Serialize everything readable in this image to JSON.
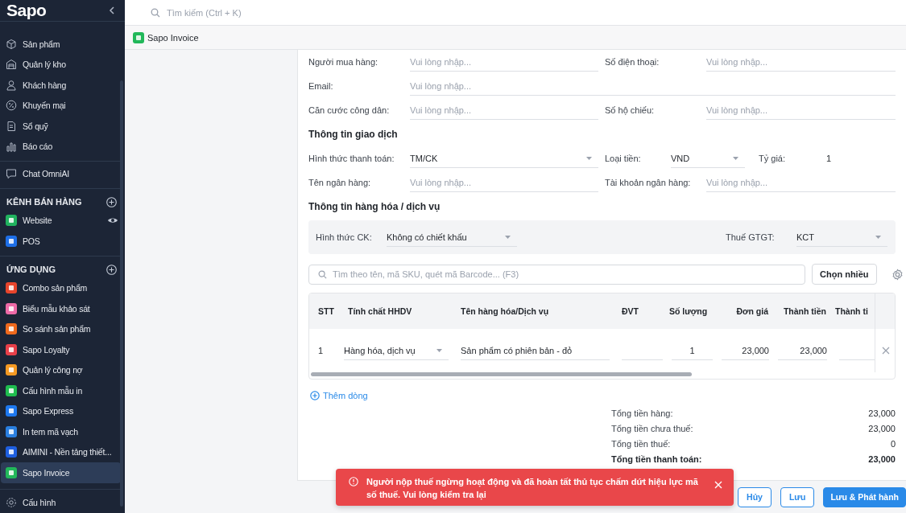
{
  "sidebar": {
    "logo": "Sapo",
    "groups": [
      {
        "items": [
          {
            "label": "Sản phẩm",
            "selected": false
          },
          {
            "label": "Quản lý kho",
            "selected": false
          },
          {
            "label": "Khách hàng",
            "selected": false
          },
          {
            "label": "Khuyến mại",
            "selected": false
          },
          {
            "label": "Sổ quỹ",
            "selected": false
          },
          {
            "label": "Báo cáo",
            "selected": false
          }
        ]
      },
      {
        "items": [
          {
            "label": "Chat OmniAI",
            "selected": false
          }
        ]
      },
      {
        "heading": "KÊNH BÁN HÀNG",
        "items": [
          {
            "label": "Website",
            "selected": false,
            "color": "#21b35f"
          },
          {
            "label": "POS",
            "selected": false,
            "color": "#1e6fe8"
          }
        ]
      },
      {
        "heading": "ỨNG DỤNG",
        "items": [
          {
            "label": "Combo sản phẩm",
            "selected": false,
            "color": "#e8452c"
          },
          {
            "label": "Biểu mẫu khảo sát",
            "selected": false,
            "color": "#ee6aa7"
          },
          {
            "label": "So sánh sản phẩm",
            "selected": false,
            "color": "#f06a1d"
          },
          {
            "label": "Sapo Loyalty",
            "selected": false,
            "color": "#e8404a"
          },
          {
            "label": "Quản lý công nợ",
            "selected": false,
            "color": "#f59a23"
          },
          {
            "label": "Cấu hình mẫu in",
            "selected": false,
            "color": "#1fbd4f"
          },
          {
            "label": "Sapo Express",
            "selected": false,
            "color": "#1d78f0"
          },
          {
            "label": "In tem mã vạch",
            "selected": false,
            "color": "#2a7fe0"
          },
          {
            "label": "AIMINI - Nền tảng thiết...",
            "selected": false,
            "color": "#1e5fe0"
          },
          {
            "label": "Sapo Invoice",
            "selected": true,
            "color": "#22b85a"
          }
        ]
      },
      {
        "items": [
          {
            "label": "Cấu hình",
            "selected": false
          }
        ]
      }
    ]
  },
  "topbar": {
    "search_placeholder": "Tìm kiếm (Ctrl + K)"
  },
  "app_header": {
    "title": "Sapo Invoice"
  },
  "form": {
    "buyer_rows": [
      [
        {
          "label": "Người mua hàng:",
          "placeholder": "Vui lòng nhập..."
        },
        {
          "label": "Số điện thoại:",
          "placeholder": "Vui lòng nhập..."
        }
      ],
      [
        {
          "label": "Email:",
          "placeholder": "Vui lòng nhập..."
        }
      ],
      [
        {
          "label": "Căn cước công dân:",
          "placeholder": "Vui lòng nhập..."
        },
        {
          "label": "Số hộ chiếu:",
          "placeholder": "Vui lòng nhập..."
        }
      ]
    ],
    "transaction": {
      "title": "Thông tin giao dịch",
      "rows": [
        [
          {
            "kind": "select",
            "label": "Hình thức thanh toán:",
            "value": "TM/CK"
          },
          {
            "kind": "select",
            "label": "Loại tiền:",
            "value": "VND"
          },
          {
            "kind": "text",
            "label": "Tỷ giá:",
            "value": "1"
          }
        ],
        [
          {
            "kind": "input",
            "label": "Tên ngân hàng:",
            "placeholder": "Vui lòng nhập..."
          },
          {
            "kind": "input",
            "label": "Tài khoản ngân hàng:",
            "placeholder": "Vui lòng nhập..."
          }
        ]
      ]
    },
    "goods": {
      "title": "Thông tin hàng hóa / dịch vụ",
      "discount": {
        "label": "Hình thức CK:",
        "value": "Không có chiết khấu"
      },
      "vat": {
        "label": "Thuế GTGT:",
        "value": "KCT"
      },
      "search_placeholder": "Tìm theo tên, mã SKU, quét mã Barcode... (F3)",
      "pick_button": "Chọn nhiều",
      "columns": [
        "STT",
        "Tính chất HHDV",
        "Tên hàng hóa/Dịch vụ",
        "ĐVT",
        "Số lượng",
        "Đơn giá",
        "Thành tiền",
        "Thành ti"
      ],
      "rows": [
        {
          "stt": "1",
          "type": "Hàng hóa, dịch vụ",
          "name": "Sản phẩm có phiên bản - đỏ",
          "quantity": "1",
          "price": "23,000",
          "amount": "23,000"
        }
      ],
      "add_row": "Thêm dòng"
    },
    "totals": [
      {
        "label": "Tổng tiền hàng:",
        "value": "23,000",
        "emphasis": false
      },
      {
        "label": "Tổng tiền chưa thuế:",
        "value": "23,000",
        "emphasis": false
      },
      {
        "label": "Tổng tiền thuế:",
        "value": "0",
        "emphasis": false
      },
      {
        "label": "Tổng tiền thanh toán:",
        "value": "23,000",
        "emphasis": true
      }
    ]
  },
  "actions": [
    {
      "label": "Hủy",
      "kind": "outline"
    },
    {
      "label": "Lưu",
      "kind": "outline"
    },
    {
      "label": "Lưu & Phát hành",
      "kind": "primary"
    }
  ],
  "toast": {
    "kind": "error",
    "message": "Người nộp thuế ngừng hoạt động và đã hoàn tất thủ tục chấm dứt hiệu lực mã số thuế. Vui lòng kiểm tra lại"
  }
}
